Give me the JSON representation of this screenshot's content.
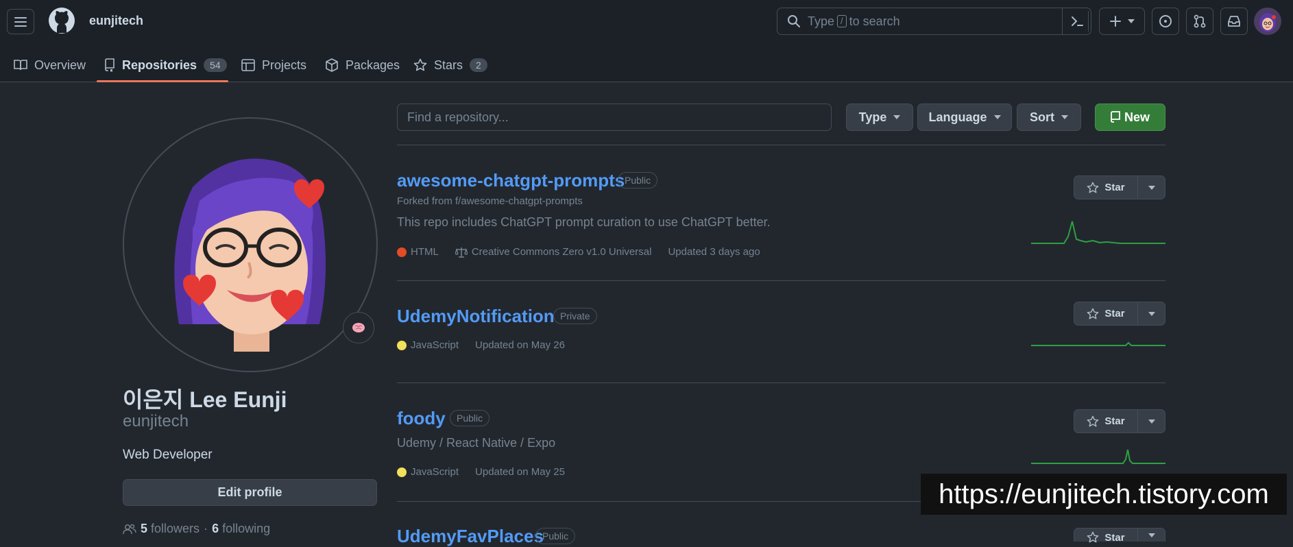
{
  "header": {
    "owner": "eunjitech",
    "search_prefix": "Type",
    "search_key": "/",
    "search_suffix": "to search"
  },
  "tabs": [
    {
      "label": "Overview",
      "icon": "book-icon"
    },
    {
      "label": "Repositories",
      "count": "54",
      "icon": "repo-icon",
      "active": true
    },
    {
      "label": "Projects",
      "icon": "table-icon"
    },
    {
      "label": "Packages",
      "icon": "package-icon"
    },
    {
      "label": "Stars",
      "count": "2",
      "icon": "star-icon"
    }
  ],
  "profile": {
    "fullname": "이은지 Lee Eunji",
    "login": "eunjitech",
    "bio": "Web Developer",
    "edit_label": "Edit profile",
    "followers_count": "5",
    "followers_label": "followers",
    "separator": "·",
    "following_count": "6",
    "following_label": "following"
  },
  "filters": {
    "find_placeholder": "Find a repository...",
    "type_label": "Type",
    "language_label": "Language",
    "sort_label": "Sort",
    "new_label": "New"
  },
  "repos": [
    {
      "name": "awesome-chatgpt-prompts",
      "visibility": "Public",
      "forked_from": "Forked from f/awesome-chatgpt-prompts",
      "description": "This repo includes ChatGPT prompt curation to use ChatGPT better.",
      "language": "HTML",
      "language_color": "#e34c26",
      "license": "Creative Commons Zero v1.0 Universal",
      "updated": "Updated 3 days ago",
      "star_label": "Star"
    },
    {
      "name": "UdemyNotification",
      "visibility": "Private",
      "language": "JavaScript",
      "language_color": "#f1e05a",
      "updated": "Updated on May 26",
      "star_label": "Star"
    },
    {
      "name": "foody",
      "visibility": "Public",
      "description": "Udemy / React Native / Expo",
      "language": "JavaScript",
      "language_color": "#f1e05a",
      "updated": "Updated on May 25",
      "star_label": "Star"
    },
    {
      "name": "UdemyFavPlaces",
      "visibility": "Public",
      "star_label": "Star"
    }
  ],
  "watermark": "https://eunjitech.tistory.com",
  "colors": {
    "link": "#539bf5",
    "accent_underline": "#ec775c",
    "new_button": "#347d39",
    "sparkline": "#2ea043"
  }
}
